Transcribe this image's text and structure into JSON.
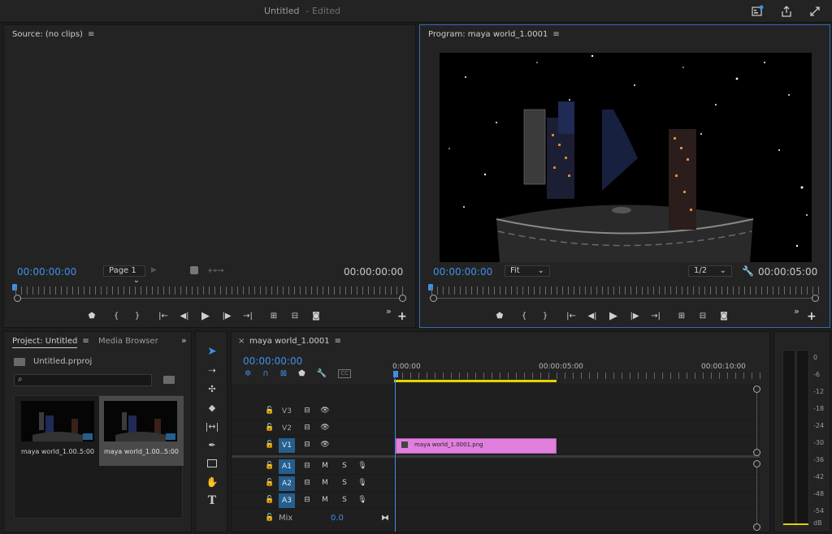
{
  "window": {
    "title": "Untitled",
    "status": "- Edited"
  },
  "source": {
    "title": "Source: (no clips)",
    "timecode_in": "00:00:00:00",
    "page_select": "Page 1",
    "timecode_out": "00:00:00:00"
  },
  "program": {
    "title": "Program: maya world_1.0001",
    "timecode_in": "00:00:00:00",
    "fit_select": "Fit",
    "res_select": "1/2",
    "timecode_out": "00:00:05:00"
  },
  "project": {
    "tab_project": "Project: Untitled",
    "tab_media": "Media Browser",
    "file": "Untitled.prproj",
    "search_placeholder": "",
    "items": [
      {
        "name": "maya world_1.00...",
        "duration": "5:00"
      },
      {
        "name": "maya world_1.00...",
        "duration": "5:00"
      }
    ]
  },
  "timeline": {
    "tab": "maya world_1.0001",
    "timecode": "00:00:00:00",
    "ruler": [
      "0:00:00",
      "00:00:05:00",
      "00:00:10:00"
    ],
    "video_tracks": [
      "V3",
      "V2",
      "V1"
    ],
    "audio_tracks": [
      "A1",
      "A2",
      "A3"
    ],
    "mute_label": "M",
    "solo_label": "S",
    "clip_name": "maya world_1.0001.png",
    "mix_label": "Mix",
    "mix_value": "0.0",
    "clip_color": "#e07fdc"
  },
  "meter": {
    "db": [
      "0",
      "-6",
      "-12",
      "-18",
      "-24",
      "-30",
      "-36",
      "-42",
      "-48",
      "-54",
      "dB"
    ]
  },
  "colors": {
    "accent": "#3f8fe8",
    "work_area": "#e6d400"
  }
}
